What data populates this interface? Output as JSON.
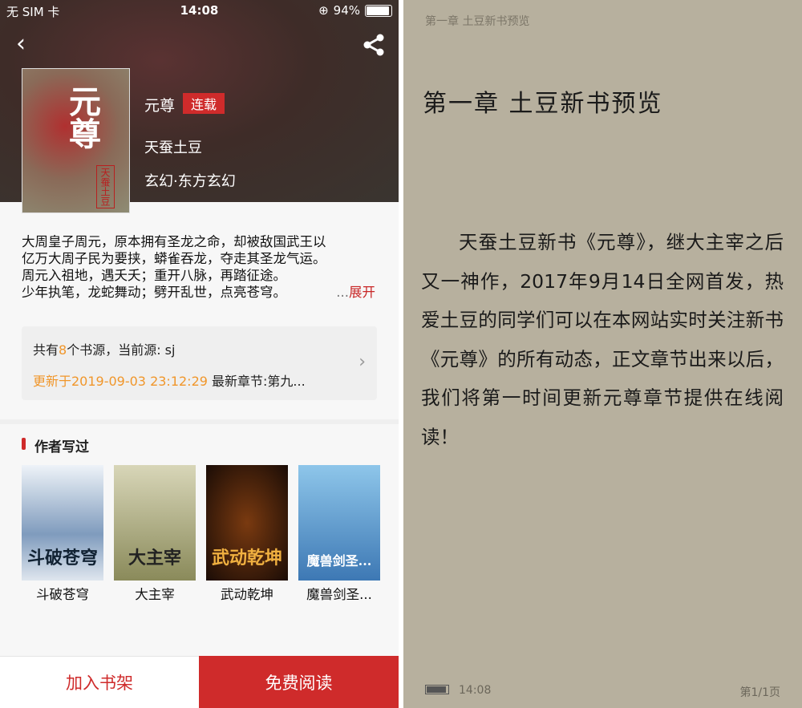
{
  "status": {
    "carrier": "无 SIM 卡",
    "time": "14:08",
    "battery": "94%",
    "battery_level": 0.94
  },
  "book": {
    "title": "元尊",
    "status_tag": "连载",
    "author": "天蚕土豆",
    "genre": "玄幻·东方玄幻",
    "cover_title": "元尊",
    "cover_author": "天蚕土豆"
  },
  "description": {
    "lines": [
      "大周皇子周元，原本拥有圣龙之命，却被敌国武王以",
      "亿万大周子民为要挟，蟒雀吞龙，夺走其圣龙气运。",
      "周元入祖地，遇夭夭；重开八脉，再踏征途。",
      "少年执笔，龙蛇舞动；劈开乱世，点亮苍穹。"
    ],
    "ellipsis": "...",
    "expand": "展开"
  },
  "source": {
    "prefix": "共有",
    "count": "8",
    "suffix": "个书源，当前源: sj",
    "updated": "更新于2019-09-03 23:12:29",
    "latest": " 最新章节:第九..."
  },
  "section_title": "作者写过",
  "books": [
    {
      "name": "斗破苍穹"
    },
    {
      "name": "大主宰"
    },
    {
      "name": "武动乾坤"
    },
    {
      "name": "魔兽剑圣..."
    }
  ],
  "actions": {
    "add": "加入书架",
    "read": "免费阅读"
  },
  "reader": {
    "header": "第一章 土豆新书预览",
    "title": "第一章 土豆新书预览",
    "body": "天蚕土豆新书《元尊》，继大主宰之后又一神作，2017年9月14日全网首发，热爱土豆的同学们可以在本网站实时关注新书《元尊》的所有动态，正文章节出来以后，我们将第一时间更新元尊章节提供在线阅读！",
    "time": "14:08",
    "page": "第1/1页"
  },
  "colors": {
    "accent": "#cf2b2b",
    "orange": "#f0962a",
    "paper": "#b7b09e"
  }
}
